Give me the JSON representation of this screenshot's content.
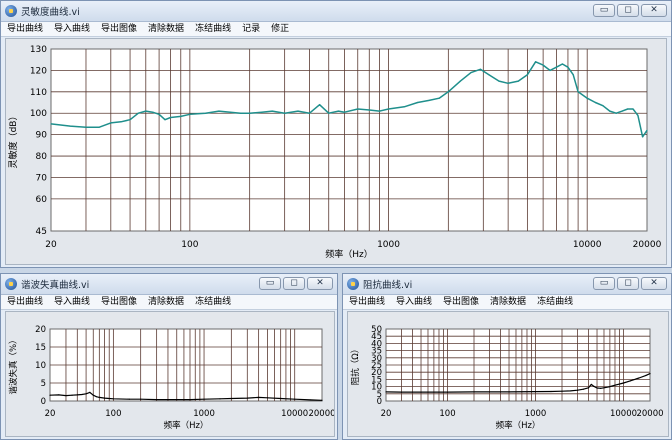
{
  "windows": {
    "sens": {
      "title": "灵敏度曲线.vi",
      "menu": [
        "导出曲线",
        "导入曲线",
        "导出图像",
        "清除数据",
        "冻结曲线",
        "记录",
        "修正"
      ]
    },
    "thd": {
      "title": "谐波失真曲线.vi",
      "menu": [
        "导出曲线",
        "导入曲线",
        "导出图像",
        "清除数据",
        "冻结曲线"
      ]
    },
    "imp": {
      "title": "阻抗曲线.vi",
      "menu": [
        "导出曲线",
        "导入曲线",
        "导出图像",
        "清除数据",
        "冻结曲线"
      ]
    }
  },
  "title_buttons": {
    "minimize": "▭",
    "restore": "◻",
    "close": "✕"
  },
  "chart_data": [
    {
      "type": "line",
      "window": "sens",
      "xscale": "log",
      "xlim": [
        20,
        20000
      ],
      "ylim": [
        45,
        130
      ],
      "xticks": [
        20,
        100,
        1000,
        10000,
        20000
      ],
      "yticks": [
        45,
        60,
        70,
        80,
        90,
        100,
        110,
        120,
        130
      ],
      "xlabel": "频率（Hz）",
      "ylabel": "灵敏度（dB）",
      "line_color": "#1f8f8c",
      "grid_color": "#5a3a32",
      "x": [
        20,
        25,
        30,
        35,
        40,
        45,
        50,
        55,
        60,
        65,
        70,
        75,
        80,
        90,
        100,
        120,
        140,
        160,
        180,
        200,
        230,
        260,
        300,
        350,
        400,
        450,
        500,
        560,
        600,
        700,
        800,
        900,
        1000,
        1200,
        1400,
        1600,
        1800,
        2000,
        2300,
        2600,
        2900,
        3200,
        3600,
        4000,
        4500,
        5000,
        5500,
        6000,
        6500,
        7000,
        7500,
        8000,
        8500,
        9000,
        10000,
        11000,
        12000,
        13000,
        14000,
        15000,
        16000,
        17000,
        18000,
        19000,
        20000
      ],
      "y": [
        95,
        94,
        93.5,
        93.5,
        95.5,
        96,
        97,
        100,
        101,
        100.5,
        99.5,
        97,
        98,
        98.5,
        99.5,
        100,
        101,
        100.5,
        100,
        100,
        100.5,
        101,
        100,
        101,
        100,
        104,
        100,
        101,
        100.5,
        102,
        101.5,
        101,
        102,
        103,
        105,
        106,
        107,
        110,
        115,
        119,
        120.5,
        118,
        115,
        114,
        115,
        118,
        124,
        122.5,
        120,
        121.5,
        123,
        121.5,
        118,
        110,
        107,
        105,
        103.5,
        101,
        100,
        101,
        102,
        102,
        99,
        89,
        92
      ]
    },
    {
      "type": "line",
      "window": "thd",
      "xscale": "log",
      "xlim": [
        20,
        20000
      ],
      "ylim": [
        0,
        20
      ],
      "xticks": [
        20,
        100,
        1000,
        10000,
        20000
      ],
      "yticks": [
        0,
        5,
        10,
        15,
        20
      ],
      "xlabel": "频率（Hz）",
      "ylabel": "谐波失真（%）",
      "line_color": "#000000",
      "grid_color": "#5a3a32",
      "x": [
        20,
        25,
        30,
        35,
        40,
        45,
        50,
        55,
        60,
        65,
        70,
        80,
        90,
        100,
        150,
        200,
        300,
        400,
        500,
        700,
        1000,
        1500,
        2000,
        3000,
        4000,
        5000,
        7000,
        10000,
        15000,
        20000
      ],
      "y": [
        1.6,
        1.7,
        1.5,
        1.6,
        1.7,
        1.8,
        2.0,
        2.4,
        1.6,
        1.2,
        1.0,
        0.8,
        0.7,
        0.6,
        0.5,
        0.5,
        0.4,
        0.4,
        0.4,
        0.4,
        0.5,
        0.6,
        0.7,
        0.8,
        1.0,
        0.9,
        0.7,
        0.5,
        0.3,
        0.2
      ]
    },
    {
      "type": "line",
      "window": "imp",
      "xscale": "log",
      "xlim": [
        20,
        20000
      ],
      "ylim": [
        0,
        50
      ],
      "xticks": [
        20,
        100,
        1000,
        10000,
        20000
      ],
      "yticks": [
        0,
        5,
        10,
        15,
        20,
        25,
        30,
        35,
        40,
        45,
        50
      ],
      "xlabel": "频率（Hz）",
      "ylabel": "阻抗（Ω）",
      "line_color": "#000000",
      "grid_color": "#5a3a32",
      "x": [
        20,
        30,
        50,
        100,
        200,
        500,
        1000,
        1500,
        2000,
        2500,
        3000,
        3500,
        4000,
        4300,
        4600,
        5000,
        5500,
        6000,
        7000,
        8000,
        10000,
        12000,
        15000,
        18000,
        20000
      ],
      "y": [
        6.3,
        6.2,
        6.2,
        6.2,
        6.3,
        6.3,
        6.5,
        6.6,
        6.8,
        7.0,
        7.5,
        8.2,
        9.2,
        11.5,
        10.2,
        9.0,
        8.8,
        9.2,
        10.0,
        11.0,
        12.5,
        14.0,
        16.0,
        17.8,
        19.0
      ]
    }
  ]
}
